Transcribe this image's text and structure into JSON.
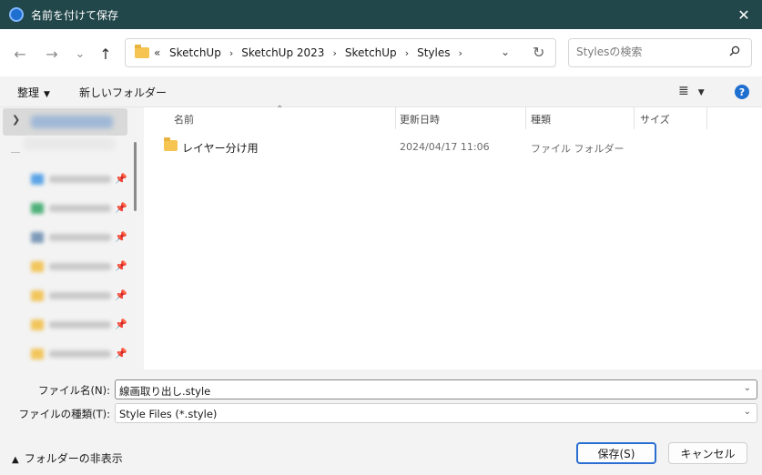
{
  "window": {
    "title": "名前を付けて保存",
    "close_glyph": "✕"
  },
  "nav": {
    "back": "←",
    "forward": "→",
    "recent": "⌄",
    "up": "↑"
  },
  "address": {
    "overflow": "«",
    "crumbs": [
      "SketchUp",
      "SketchUp 2023",
      "SketchUp",
      "Styles"
    ],
    "separator": "›",
    "dropdown": "⌄",
    "refresh": "↻"
  },
  "search": {
    "placeholder": "Stylesの検索",
    "icon": "search-icon"
  },
  "toolbar": {
    "organize": "整理",
    "new_folder": "新しいフォルダー",
    "view_glyph": "≣",
    "help": "?"
  },
  "columns": {
    "name": "名前",
    "date": "更新日時",
    "type": "種類",
    "size": "サイズ"
  },
  "files": [
    {
      "name": "レイヤー分け用",
      "date": "2024/04/17 11:06",
      "type": "ファイル フォルダー",
      "size": ""
    }
  ],
  "fields": {
    "filename_label": "ファイル名(N):",
    "filename_value": "線画取り出し.style",
    "filetype_label": "ファイルの種類(T):",
    "filetype_value": "Style Files (*.style)"
  },
  "footer": {
    "hide_folders": "フォルダーの非表示",
    "save": "保存(S)",
    "cancel": "キャンセル"
  },
  "colors": {
    "titlebar": "#22474a",
    "accent": "#2b6ed1",
    "folder": "#f5c451"
  }
}
